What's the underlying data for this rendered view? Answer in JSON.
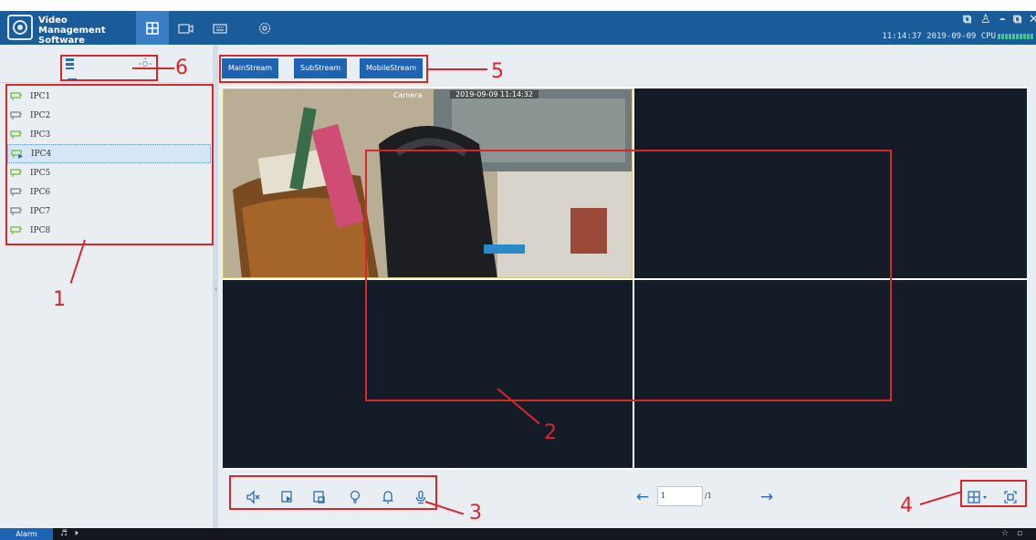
{
  "app": {
    "title": "Video Management Software",
    "clock": "11:14:37 2019-09-09 CPU"
  },
  "nav": {
    "tabs": [
      {
        "name": "live-view",
        "icon": "grid-icon",
        "active": true
      },
      {
        "name": "playback",
        "icon": "video-camera-icon",
        "active": false
      },
      {
        "name": "device",
        "icon": "keyboard-icon",
        "active": false
      },
      {
        "name": "settings",
        "icon": "gear-icon",
        "active": false
      }
    ]
  },
  "window_controls": [
    "⧉",
    "👤",
    "–",
    "⧉",
    "✕"
  ],
  "devices": [
    {
      "label": "IPC1",
      "status": "online",
      "selected": false
    },
    {
      "label": "IPC2",
      "status": "offline",
      "selected": false
    },
    {
      "label": "IPC3",
      "status": "online",
      "selected": false
    },
    {
      "label": "IPC4",
      "status": "playing",
      "selected": true
    },
    {
      "label": "IPC5",
      "status": "online",
      "selected": false
    },
    {
      "label": "IPC6",
      "status": "offline",
      "selected": false
    },
    {
      "label": "IPC7",
      "status": "offline",
      "selected": false
    },
    {
      "label": "IPC8",
      "status": "online",
      "selected": false
    }
  ],
  "streams": {
    "main": "MainStream",
    "sub": "SubStream",
    "mobile": "MobileStream"
  },
  "video": {
    "camera_label": "Camera",
    "timestamp": "2019-09-09 11:14:32"
  },
  "pagination": {
    "current": "1",
    "total": "/1"
  },
  "status": {
    "alarm": "Alarm"
  },
  "annotations": [
    "1",
    "2",
    "3",
    "4",
    "5",
    "6"
  ],
  "colors": {
    "titlebar": "#1a5b9a",
    "accent": "#1f64b3",
    "online": "#7ac04a",
    "offline": "#8a8a8a",
    "annotation": "#d8262b"
  }
}
